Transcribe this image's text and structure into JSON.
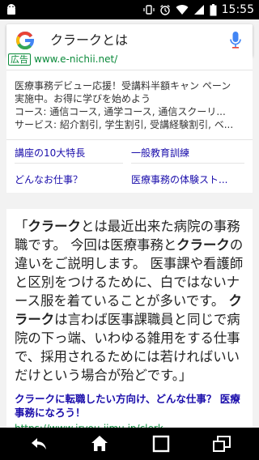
{
  "status_bar": {
    "time": "15:55"
  },
  "search": {
    "query": "クラークとは"
  },
  "ad": {
    "badge": "広告",
    "url": "www.e-nichii.net/",
    "lines": [
      "医療事務デビュー応援！受講料半額キャン ペーン",
      "実施中。お得に学びを始めよう",
      "コース: 通信コース, 通学コース, 通信スクーリ...",
      "サービス: 紹介割引, 学生割引, 受講経験割引, ベ..."
    ],
    "sitelinks": [
      "講座の10大特長",
      "一般教育訓練",
      "どんなお仕事？",
      "医療事務の体験スト..."
    ]
  },
  "answer": {
    "lines": [
      [
        {
          "t": "「"
        },
        {
          "t": "クラーク",
          "b": true
        },
        {
          "t": "とは最近出来た病院の事務"
        }
      ],
      [
        {
          "t": "職です。 今回は医療事務と"
        },
        {
          "t": "クラーク",
          "b": true
        },
        {
          "t": "の"
        }
      ],
      [
        {
          "t": "違いをご説明します。 医事課や看護師"
        }
      ],
      [
        {
          "t": "と区別をつけるために、白ではないナ"
        }
      ],
      [
        {
          "t": "ース服を着ていることが多いです。 "
        },
        {
          "t": "ク",
          "b": true
        }
      ],
      [
        {
          "t": "ラーク",
          "b": true
        },
        {
          "t": "は言わば医事課職員と同じで病"
        }
      ],
      [
        {
          "t": "院の下っ端、いわゆる雑用をする仕事"
        }
      ],
      [
        {
          "t": "で、採用されるためには若ければいい"
        }
      ],
      [
        {
          "t": "だけという場合が殆どです。」"
        }
      ]
    ]
  },
  "result": {
    "title_line1": "クラークに転職したい方向け、どんな仕事？ 医療",
    "title_line2": "事務になろう！",
    "url": "https://www.iryou-jimu.jp/clerk"
  },
  "colors": {
    "link": "#1a0dab",
    "url_green": "#0a8a3a",
    "background": "#f2f2f2"
  },
  "icons": {
    "status_left": "android-icon",
    "status_right": [
      "vibrate-icon",
      "alarm-icon",
      "wifi-icon",
      "signal-icon",
      "battery-icon"
    ],
    "search": [
      "google-logo-icon",
      "mic-icon"
    ],
    "nav": [
      "back-icon",
      "home-icon",
      "recents-icon",
      "window-icon"
    ]
  }
}
